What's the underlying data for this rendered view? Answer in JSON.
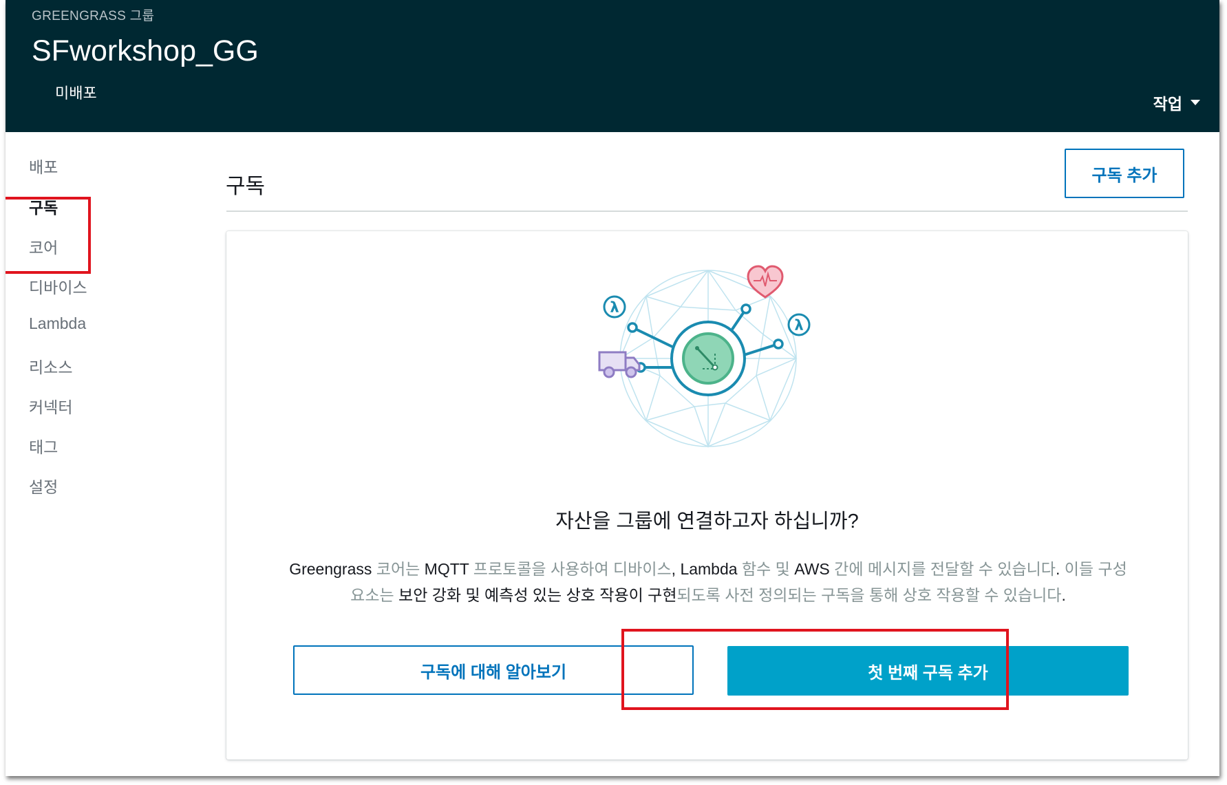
{
  "header": {
    "breadcrumb": "GREENGRASS 그룹",
    "title": "SFworkshop_GG",
    "status": "미배포",
    "actions_label": "작업"
  },
  "sidebar": {
    "items": [
      {
        "label": "배포",
        "active": false
      },
      {
        "label": "구독",
        "active": true
      },
      {
        "label": "코어",
        "active": false
      },
      {
        "label": "디바이스",
        "active": false
      },
      {
        "label": "Lambda",
        "active": false
      },
      {
        "label": "리소스",
        "active": false
      },
      {
        "label": "커넥터",
        "active": false
      },
      {
        "label": "태그",
        "active": false
      },
      {
        "label": "설정",
        "active": false
      }
    ]
  },
  "main": {
    "title": "구독",
    "add_subscription_label": "구독 추가"
  },
  "empty_state": {
    "heading": "자산을 그룹에 연결하고자 하십니까?",
    "description_parts": [
      {
        "text": "Greengrass",
        "strong": true
      },
      {
        "text": " 코어는 ",
        "strong": false
      },
      {
        "text": "MQTT",
        "strong": true
      },
      {
        "text": " 프로토콜을 사용하여 디바이스",
        "strong": false
      },
      {
        "text": ",",
        "strong": true
      },
      {
        "text": " ",
        "strong": false
      },
      {
        "text": "Lambda",
        "strong": true
      },
      {
        "text": " 함수 및 ",
        "strong": false
      },
      {
        "text": "AWS",
        "strong": true
      },
      {
        "text": " 간에 메시지를 전달할 수 있습니다",
        "strong": false
      },
      {
        "text": ".",
        "strong": true
      },
      {
        "text": " 이들 구성 요소는 ",
        "strong": false
      },
      {
        "text": "보안 강화 및 예측성 있는 상호 작용이 구현",
        "strong": true
      },
      {
        "text": "되도록 사전 정의되는 구독을 통해 상호 작용할 수 있습니다",
        "strong": false
      },
      {
        "text": ".",
        "strong": true
      }
    ],
    "learn_more_label": "구독에 대해 알아보기",
    "add_first_label": "첫 번째 구독 추가"
  },
  "colors": {
    "header_bg": "#002832",
    "accent": "#0073bb",
    "primary_button": "#00a1c9",
    "highlight": "#e0141e"
  },
  "icons": [
    "lambda-icon",
    "heart-monitor-icon",
    "truck-icon",
    "core-dial-icon",
    "caret-down-icon"
  ]
}
